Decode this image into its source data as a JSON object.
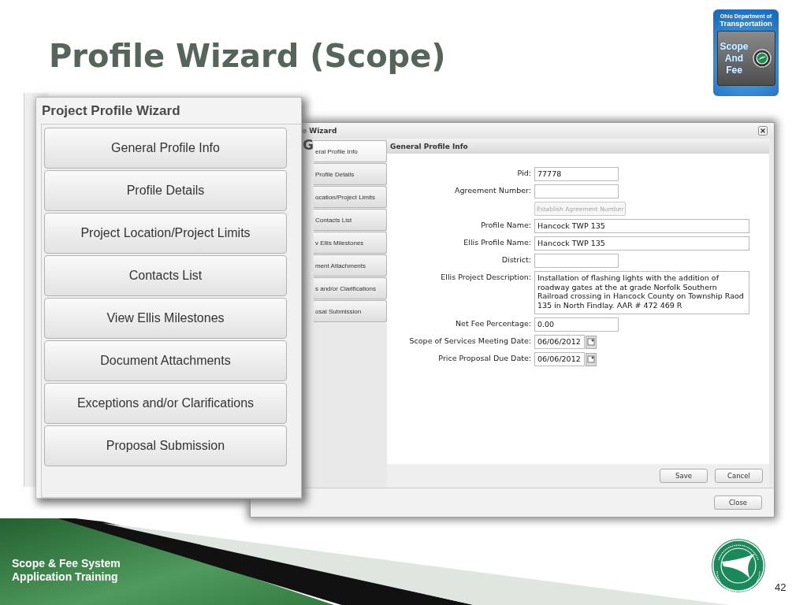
{
  "slide": {
    "title": "Profile Wizard (Scope)",
    "footer_lines": [
      "Scope & Fee System",
      "Application Training"
    ],
    "page_number": "42"
  },
  "logo": {
    "header": [
      "Ohio Department of",
      "Transportation"
    ],
    "words": [
      "Scope",
      "And",
      "Fee"
    ]
  },
  "back_window": {
    "title": "e Wizard",
    "heading_fragment": "G",
    "tabs": [
      {
        "label": "eral Profile Info",
        "selected": true
      },
      {
        "label": "Profile Details",
        "selected": false
      },
      {
        "label": "ocation/Project Limits",
        "selected": false
      },
      {
        "label": "Contacts List",
        "selected": false
      },
      {
        "label": "v Ellis Milestones",
        "selected": false
      },
      {
        "label": "ment Attachments",
        "selected": false
      },
      {
        "label": "s and/or Clarifications",
        "selected": false
      },
      {
        "label": "osal Submission",
        "selected": false
      }
    ],
    "panel_title": "General Profile Info",
    "fields": [
      {
        "kind": "short",
        "label": "Pid:",
        "value": "77778"
      },
      {
        "kind": "short",
        "label": "Agreement Number:"
      },
      {
        "kind": "action",
        "label": "Establish Agreement Number",
        "disabled": true
      },
      {
        "kind": "long",
        "label": "Profile Name:",
        "value": "Hancock TWP 135"
      },
      {
        "kind": "long",
        "label": "Ellis Profile Name:",
        "value": "Hancock TWP 135"
      },
      {
        "kind": "short",
        "label": "District:"
      },
      {
        "kind": "memo",
        "label": "Ellis Project Description:",
        "value": "Installation of flashing lights with the addition of roadway gates at the at grade  Norfolk Southern Railroad crossing in Hancock County on Township Raod 135 in North Findlay. AAR # 472 469 R"
      },
      {
        "kind": "short",
        "label": "Net Fee Percentage:",
        "value": "0.00"
      },
      {
        "kind": "date",
        "label": "Scope of Services Meeting Date:",
        "value": "06/06/2012"
      },
      {
        "kind": "date",
        "label": "Price Proposal Due Date:",
        "value": "06/06/2012"
      }
    ],
    "buttons": [
      "Save",
      "Cancel"
    ],
    "close_button": "Close"
  },
  "front_window": {
    "title": "Project Profile Wizard",
    "buttons": [
      "General Profile Info",
      "Profile Details",
      "Project Location/Project Limits",
      "Contacts List",
      "View Ellis Milestones",
      "Document Attachments",
      "Exceptions and/or Clarifications",
      "Proposal Submission"
    ]
  }
}
